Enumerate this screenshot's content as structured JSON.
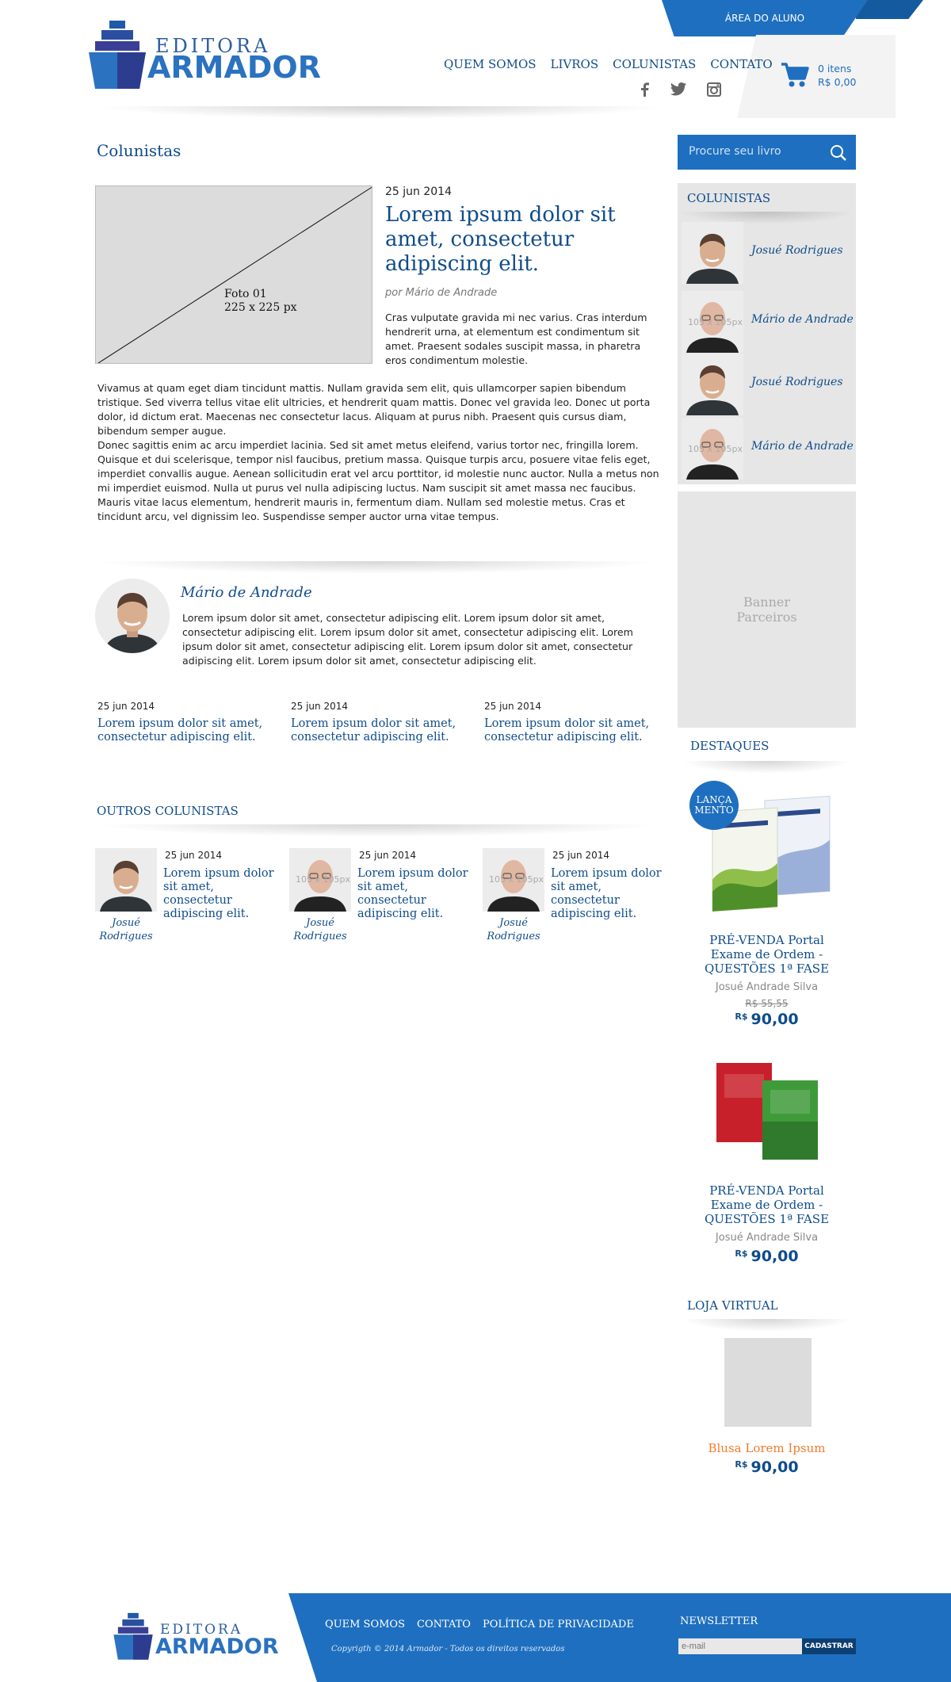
{
  "header": {
    "aluno_label": "ÁREA DO ALUNO",
    "logo_top": "EDITORA",
    "logo_bottom": "ARMADOR",
    "nav": [
      "QUEM SOMOS",
      "LIVROS",
      "COLUNISTAS",
      "CONTATO"
    ],
    "social": [
      "facebook-icon",
      "twitter-icon",
      "instagram-icon"
    ],
    "cart_items": "0 itens",
    "cart_total": "R$ 0,00"
  },
  "main": {
    "page_title": "Colunistas",
    "photo_label_1": "Foto 01",
    "photo_label_2": "225 x 225 px",
    "article": {
      "date": "25 jun 2014",
      "title": "Lorem ipsum dolor sit amet, consectetur adipiscing elit.",
      "author": "por Mário de Andrade",
      "lead": "Cras vulputate gravida mi nec varius. Cras interdum hendrerit urna, at elementum est condimentum sit amet. Praesent sodales suscipit massa, in pharetra eros condimentum molestie.",
      "p1": " Vivamus at quam eget diam tincidunt mattis. Nullam gravida sem elit, quis ullamcorper sapien bibendum tristique. Sed viverra tellus vitae elit ultricies, et hendrerit quam mattis. Donec vel gravida leo. Donec ut porta dolor, id dictum erat. Maecenas nec consectetur lacus. Aliquam at purus nibh. Praesent quis cursus diam, bibendum semper augue.",
      "p2": "Donec sagittis enim ac arcu imperdiet lacinia. Sed sit amet metus eleifend, varius tortor nec, fringilla lorem. Quisque et dui scelerisque, tempor nisl faucibus, pretium massa. Quisque turpis arcu, posuere vitae felis eget, imperdiet convallis augue. Aenean sollicitudin erat vel arcu porttitor, id molestie nunc auctor. Nulla a metus non mi imperdiet euismod. Nulla ut purus vel nulla adipiscing luctus. Nam suscipit sit amet massa nec faucibus. Mauris vitae lacus elementum, hendrerit mauris in, fermentum diam. Nullam sed molestie metus. Cras et tincidunt arcu, vel dignissim leo. Suspendisse semper auctor urna vitae tempus."
    },
    "bio": {
      "name": "Mário de Andrade",
      "text": "Lorem ipsum dolor sit amet, consectetur adipiscing elit. Lorem ipsum dolor sit amet, consectetur adipiscing elit. Lorem ipsum dolor sit amet, consectetur adipiscing elit. Lorem ipsum dolor sit amet, consectetur adipiscing elit. Lorem ipsum dolor sit amet, consectetur adipiscing elit. Lorem ipsum dolor sit amet, consectetur adipiscing elit."
    },
    "posts": [
      {
        "date": "25 jun 2014",
        "title": "Lorem ipsum dolor sit amet, consectetur adipiscing elit."
      },
      {
        "date": "25 jun 2014",
        "title": "Lorem ipsum dolor sit amet, consectetur adipiscing elit."
      },
      {
        "date": "25 jun 2014",
        "title": "Lorem ipsum dolor sit amet, consectetur adipiscing elit."
      }
    ],
    "outros_title": "OUTROS COLUNISTAS",
    "outros": [
      {
        "name": "Josué Rodrigues",
        "date": "25 jun 2014",
        "title": "Lorem ipsum dolor sit amet, consectetur adipiscing elit.",
        "ph": ""
      },
      {
        "name": "Josué Rodrigues",
        "date": "25 jun 2014",
        "title": "Lorem ipsum dolor sit amet, consectetur adipiscing elit.",
        "ph": "105 x 105px"
      },
      {
        "name": "Josué Rodrigues",
        "date": "25 jun 2014",
        "title": "Lorem ipsum dolor sit amet, consectetur adipiscing elit.",
        "ph": "105 x 105px"
      }
    ]
  },
  "sidebar": {
    "search_placeholder": "Procure seu livro",
    "colunistas_title": "COLUNISTAS",
    "colunistas": [
      {
        "name": "Josué Rodrigues",
        "ph": ""
      },
      {
        "name": "Mário de Andrade",
        "ph": "105 x 105px"
      },
      {
        "name": "Josué Rodrigues",
        "ph": ""
      },
      {
        "name": "Mário de Andrade",
        "ph": "105 x 105px"
      }
    ],
    "banner_1": "Banner",
    "banner_2": "Parceiros",
    "destaques_title": "DESTAQUES",
    "lanca_1": "LANÇA",
    "lanca_2": "MENTO",
    "products": [
      {
        "name": "PRÉ-VENDA Portal Exame de Ordem - QUESTÕES 1ª FASE",
        "author": "Josué Andrade Silva",
        "old_price": "R$ 55,55",
        "currency": "R$",
        "price": "90,00"
      },
      {
        "name": "PRÉ-VENDA Portal Exame de Ordem - QUESTÕES 1ª FASE",
        "author": "Josué Andrade Silva",
        "old_price": "",
        "currency": "R$",
        "price": "90,00"
      }
    ],
    "loja_title": "LOJA VIRTUAL",
    "shirt_name": "Blusa Lorem Ipsum",
    "shirt_currency": "R$",
    "shirt_price": "90,00"
  },
  "footer": {
    "nav": [
      "QUEM SOMOS",
      "CONTATO",
      "POLÍTICA DE PRIVACIDADE"
    ],
    "copyright": "Copyrigth © 2014 Armador - Todos os direitos reservados",
    "newsletter_title": "NEWSLETTER",
    "newsletter_placeholder": "e-mail",
    "newsletter_button": "CADASTRAR"
  },
  "colors": {
    "brand_blue": "#1e6fbf",
    "text_blue": "#0f4c8a",
    "accent_orange": "#f07c30"
  }
}
